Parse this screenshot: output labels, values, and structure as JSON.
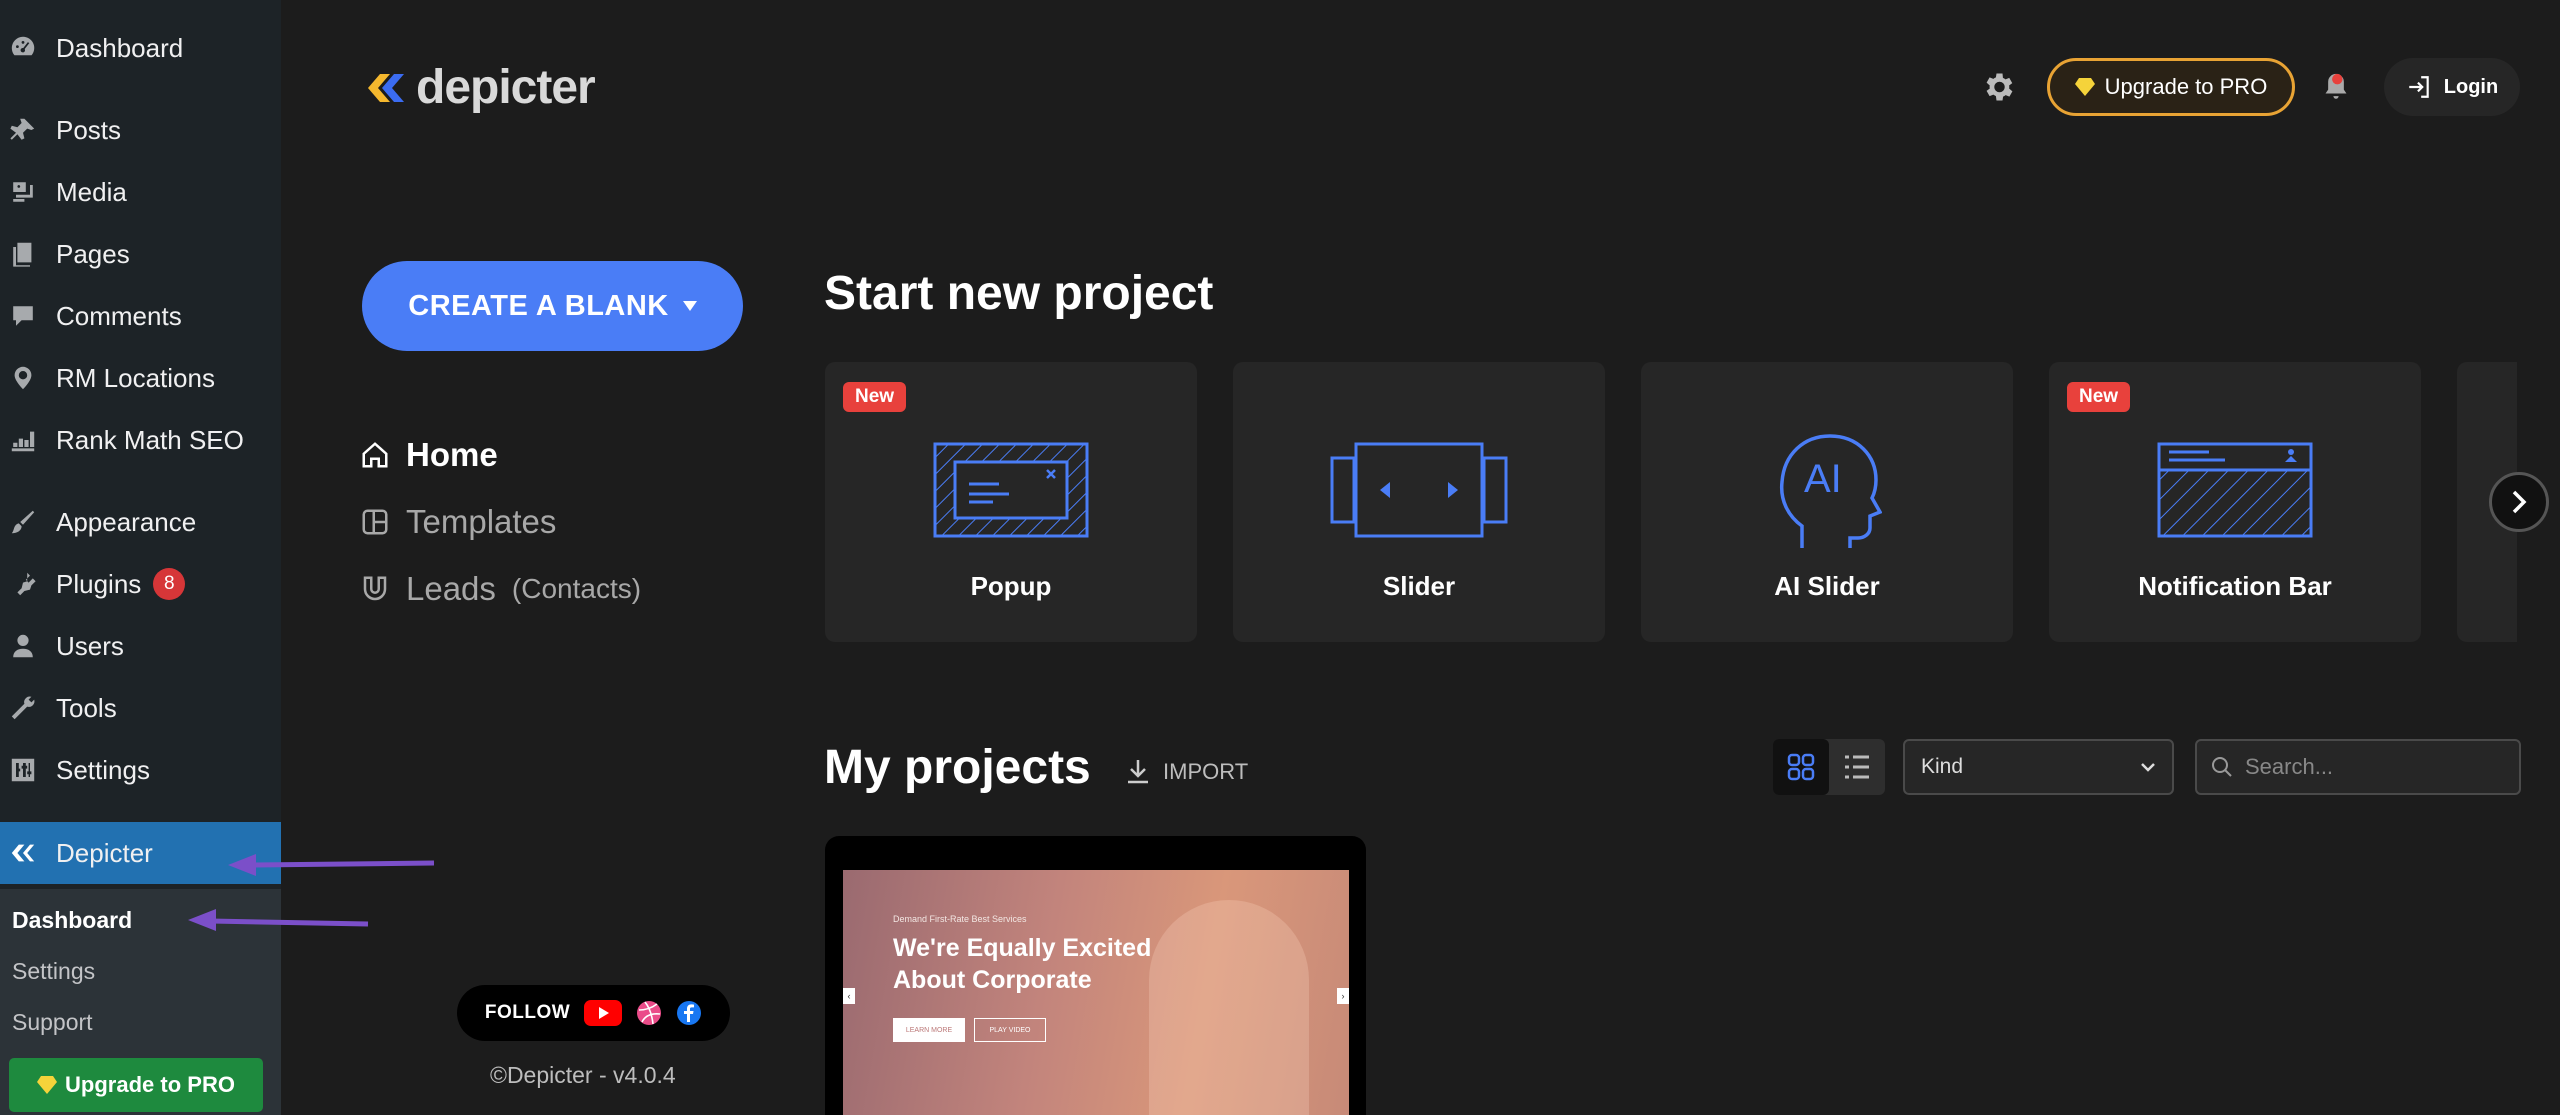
{
  "wp_sidebar": {
    "items": [
      {
        "label": "Dashboard",
        "icon": "dashboard-icon"
      },
      {
        "label": "Posts",
        "icon": "pin-icon"
      },
      {
        "label": "Media",
        "icon": "media-icon"
      },
      {
        "label": "Pages",
        "icon": "pages-icon"
      },
      {
        "label": "Comments",
        "icon": "comment-icon"
      },
      {
        "label": "RM Locations",
        "icon": "location-pin-icon"
      },
      {
        "label": "Rank Math SEO",
        "icon": "chart-icon"
      },
      {
        "label": "Appearance",
        "icon": "brush-icon"
      },
      {
        "label": "Plugins",
        "icon": "plug-icon",
        "badge": "8"
      },
      {
        "label": "Users",
        "icon": "user-icon"
      },
      {
        "label": "Tools",
        "icon": "wrench-icon"
      },
      {
        "label": "Settings",
        "icon": "settings-sliders-icon"
      },
      {
        "label": "Depicter",
        "icon": "depicter-logo-icon"
      }
    ],
    "submenu": [
      {
        "label": "Dashboard"
      },
      {
        "label": "Settings"
      },
      {
        "label": "Support"
      }
    ],
    "upgrade_label": "Upgrade to PRO"
  },
  "header": {
    "logo_text": "depicter",
    "upgrade_label": "Upgrade to PRO",
    "login_label": "Login"
  },
  "left_panel": {
    "create_label": "CREATE A BLANK",
    "nav": [
      {
        "label": "Home",
        "icon": "home-icon"
      },
      {
        "label": "Templates",
        "icon": "templates-icon"
      },
      {
        "label": "Leads",
        "suffix": "(Contacts)",
        "icon": "magnet-icon"
      }
    ],
    "follow_label": "FOLLOW",
    "copyright": "©Depicter - v4.0.4"
  },
  "start_section": {
    "title": "Start new project",
    "cards": [
      {
        "label": "Popup",
        "badge": "New",
        "icon": "popup-icon"
      },
      {
        "label": "Slider",
        "badge": "",
        "icon": "slider-icon"
      },
      {
        "label": "AI Slider",
        "badge": "",
        "icon": "ai-head-icon"
      },
      {
        "label": "Notification Bar",
        "badge": "New",
        "icon": "notification-bar-icon"
      }
    ]
  },
  "projects": {
    "title": "My projects",
    "import_label": "IMPORT",
    "kind_value": "Kind",
    "search_placeholder": "Search...",
    "items": [
      {
        "tagline": "Demand First-Rate Best Services",
        "headline": "We're Equally Excited About Corporate",
        "btn1": "LEARN MORE",
        "btn2": "PLAY VIDEO"
      }
    ]
  },
  "colors": {
    "accent": "#4a7df6",
    "wp_active": "#2271b1",
    "badge_red": "#e8413c",
    "pro_gold": "#e8a334",
    "annotation_arrow": "#7b4fc9"
  }
}
